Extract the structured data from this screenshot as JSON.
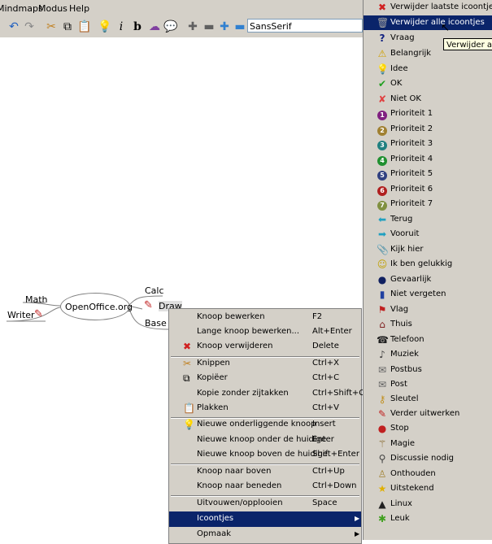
{
  "menubar": {
    "items": [
      "Mindmaps",
      "Modus",
      "Help"
    ]
  },
  "toolbar": {
    "font_name": "SansSerif"
  },
  "mindmap": {
    "root": "OpenOffice.org",
    "nodes": {
      "math": "Math",
      "writer": "Writer",
      "calc": "Calc",
      "draw": "Draw",
      "base": "Base"
    }
  },
  "context_menu": {
    "items": [
      {
        "label": "Knoop bewerken",
        "shortcut": "F2"
      },
      {
        "label": "Lange knoop bewerken...",
        "shortcut": "Alt+Enter"
      },
      {
        "label": "Knoop verwijderen",
        "shortcut": "Delete"
      },
      {
        "label": "Knippen",
        "shortcut": "Ctrl+X"
      },
      {
        "label": "Kopiëer",
        "shortcut": "Ctrl+C"
      },
      {
        "label": "Kopie zonder zijtakken",
        "shortcut": "Ctrl+Shift+C"
      },
      {
        "label": "Plakken",
        "shortcut": "Ctrl+V"
      },
      {
        "label": "Nieuwe onderliggende knoop",
        "shortcut": "Insert"
      },
      {
        "label": "Nieuwe knoop onder de huidige",
        "shortcut": "Enter"
      },
      {
        "label": "Nieuwe knoop boven de huidige",
        "shortcut": "Shift+Enter"
      },
      {
        "label": "Knoop naar boven",
        "shortcut": "Ctrl+Up"
      },
      {
        "label": "Knoop naar beneden",
        "shortcut": "Ctrl+Down"
      },
      {
        "label": "Uitvouwen/opplooien",
        "shortcut": "Space"
      },
      {
        "label": "Icoontjes",
        "shortcut": ""
      },
      {
        "label": "Opmaak",
        "shortcut": ""
      }
    ]
  },
  "icons_menu": {
    "items": [
      "Verwijder laatste icoontje",
      "Verwijder alle icoontjes",
      "Vraag",
      "Belangrijk",
      "Idee",
      "OK",
      "Niet OK",
      "Prioriteit 1",
      "Prioriteit 2",
      "Prioriteit 3",
      "Prioriteit 4",
      "Prioriteit 5",
      "Prioriteit 6",
      "Prioriteit 7",
      "Terug",
      "Vooruit",
      "Kijk hier",
      "Ik ben gelukkig",
      "Gevaarlijk",
      "Niet vergeten",
      "Vlag",
      "Thuis",
      "Telefoon",
      "Muziek",
      "Postbus",
      "Post",
      "Sleutel",
      "Verder uitwerken",
      "Stop",
      "Magie",
      "Discussie nodig",
      "Onthouden",
      "Uitstekend",
      "Linux",
      "Leuk"
    ],
    "tooltip": "Verwijder alle icoontjes"
  }
}
